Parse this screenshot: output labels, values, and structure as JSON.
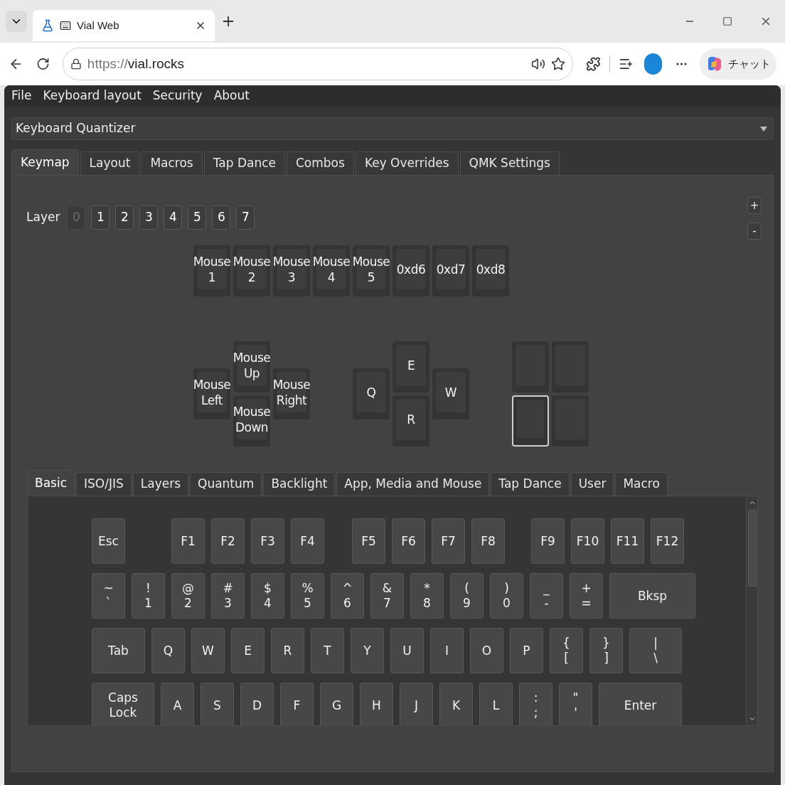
{
  "browser": {
    "tabs": [
      {
        "title": "Vial Web",
        "selected": true
      }
    ],
    "url": {
      "scheme": "https://",
      "host": "vial.rocks"
    },
    "copilot_label": "チャット"
  },
  "menu": [
    "File",
    "Keyboard layout",
    "Security",
    "About"
  ],
  "device": {
    "value": "Keyboard Quantizer"
  },
  "tabs": [
    {
      "label": "Keymap",
      "selected": true
    },
    {
      "label": "Layout",
      "selected": false
    },
    {
      "label": "Macros",
      "selected": false
    },
    {
      "label": "Tap Dance",
      "selected": false
    },
    {
      "label": "Combos",
      "selected": false
    },
    {
      "label": "Key Overrides",
      "selected": false
    },
    {
      "label": "QMK Settings",
      "selected": false
    }
  ],
  "layer": {
    "label": "Layer",
    "buttons": [
      {
        "label": "0",
        "selected": true
      },
      {
        "label": "1",
        "selected": false
      },
      {
        "label": "2",
        "selected": false
      },
      {
        "label": "3",
        "selected": false
      },
      {
        "label": "4",
        "selected": false
      },
      {
        "label": "5",
        "selected": false
      },
      {
        "label": "6",
        "selected": false
      },
      {
        "label": "7",
        "selected": false
      }
    ]
  },
  "layer_controls": [
    "+",
    "-"
  ],
  "layout_keys": [
    {
      "legend": [
        "Mouse",
        "1"
      ],
      "selected": false
    },
    {
      "legend": [
        "Mouse",
        "2"
      ],
      "selected": false
    },
    {
      "legend": [
        "Mouse",
        "3"
      ],
      "selected": false
    },
    {
      "legend": [
        "Mouse",
        "4"
      ],
      "selected": false
    },
    {
      "legend": [
        "Mouse",
        "5"
      ],
      "selected": false
    },
    {
      "legend": [
        "0xd6"
      ],
      "selected": false
    },
    {
      "legend": [
        "0xd7"
      ],
      "selected": false
    },
    {
      "legend": [
        "0xd8"
      ],
      "selected": false
    },
    {
      "legend": [
        "Mouse",
        "Left"
      ],
      "selected": false
    },
    {
      "legend": [
        "Mouse",
        "Up"
      ],
      "selected": false
    },
    {
      "legend": [
        "Mouse",
        "Down"
      ],
      "selected": false
    },
    {
      "legend": [
        "Mouse",
        "Right"
      ],
      "selected": false
    },
    {
      "legend": [
        "Q"
      ],
      "selected": false
    },
    {
      "legend": [
        "E"
      ],
      "selected": false
    },
    {
      "legend": [
        "R"
      ],
      "selected": false
    },
    {
      "legend": [
        "W"
      ],
      "selected": false
    },
    {
      "selected": false
    },
    {
      "selected": false
    },
    {
      "selected": true
    },
    {
      "selected": false
    }
  ],
  "keycode_tabs": [
    {
      "label": "Basic",
      "selected": true
    },
    {
      "label": "ISO/JIS",
      "selected": false
    },
    {
      "label": "Layers",
      "selected": false
    },
    {
      "label": "Quantum",
      "selected": false
    },
    {
      "label": "Backlight",
      "selected": false
    },
    {
      "label": "App, Media and Mouse",
      "selected": false
    },
    {
      "label": "Tap Dance",
      "selected": false
    },
    {
      "label": "User",
      "selected": false
    },
    {
      "label": "Macro",
      "selected": false
    }
  ],
  "keycodes": {
    "fn_row": [
      [
        {
          "legend": [
            "Esc"
          ]
        }
      ],
      [
        {
          "legend": [
            "F1"
          ]
        },
        {
          "legend": [
            "F2"
          ]
        },
        {
          "legend": [
            "F3"
          ]
        },
        {
          "legend": [
            "F4"
          ]
        }
      ],
      [
        {
          "legend": [
            "F5"
          ]
        },
        {
          "legend": [
            "F6"
          ]
        },
        {
          "legend": [
            "F7"
          ]
        },
        {
          "legend": [
            "F8"
          ]
        }
      ],
      [
        {
          "legend": [
            "F9"
          ]
        },
        {
          "legend": [
            "F10"
          ]
        },
        {
          "legend": [
            "F11"
          ]
        },
        {
          "legend": [
            "F12"
          ]
        }
      ]
    ],
    "rows": [
      {
        "keys": [
          {
            "legend": [
              "~",
              "`"
            ]
          },
          {
            "legend": [
              "!",
              "1"
            ]
          },
          {
            "legend": [
              "@",
              "2"
            ]
          },
          {
            "legend": [
              "#",
              "3"
            ]
          },
          {
            "legend": [
              "$",
              "4"
            ]
          },
          {
            "legend": [
              "%",
              "5"
            ]
          },
          {
            "legend": [
              "^",
              "6"
            ]
          },
          {
            "legend": [
              "&",
              "7"
            ]
          },
          {
            "legend": [
              "*",
              "8"
            ]
          },
          {
            "legend": [
              "(",
              "9"
            ]
          },
          {
            "legend": [
              ")",
              "0"
            ]
          },
          {
            "legend": [
              "_",
              "-"
            ]
          },
          {
            "legend": [
              "+",
              "="
            ]
          },
          {
            "legend": [
              "Bksp"
            ]
          }
        ]
      },
      {
        "keys": [
          {
            "legend": [
              "Tab"
            ]
          },
          {
            "legend": [
              "Q"
            ]
          },
          {
            "legend": [
              "W"
            ]
          },
          {
            "legend": [
              "E"
            ]
          },
          {
            "legend": [
              "R"
            ]
          },
          {
            "legend": [
              "T"
            ]
          },
          {
            "legend": [
              "Y"
            ]
          },
          {
            "legend": [
              "U"
            ]
          },
          {
            "legend": [
              "I"
            ]
          },
          {
            "legend": [
              "O"
            ]
          },
          {
            "legend": [
              "P"
            ]
          },
          {
            "legend": [
              "{",
              "["
            ]
          },
          {
            "legend": [
              "}",
              "]"
            ]
          },
          {
            "legend": [
              "|",
              "\\"
            ]
          }
        ]
      },
      {
        "keys": [
          {
            "legend": [
              "Caps",
              "Lock"
            ]
          },
          {
            "legend": [
              "A"
            ]
          },
          {
            "legend": [
              "S"
            ]
          },
          {
            "legend": [
              "D"
            ]
          },
          {
            "legend": [
              "F"
            ]
          },
          {
            "legend": [
              "G"
            ]
          },
          {
            "legend": [
              "H"
            ]
          },
          {
            "legend": [
              "J"
            ]
          },
          {
            "legend": [
              "K"
            ]
          },
          {
            "legend": [
              "L"
            ]
          },
          {
            "legend": [
              ":",
              ";"
            ]
          },
          {
            "legend": [
              "\"",
              "'"
            ]
          },
          {
            "legend": [
              "Enter"
            ]
          }
        ]
      }
    ]
  }
}
